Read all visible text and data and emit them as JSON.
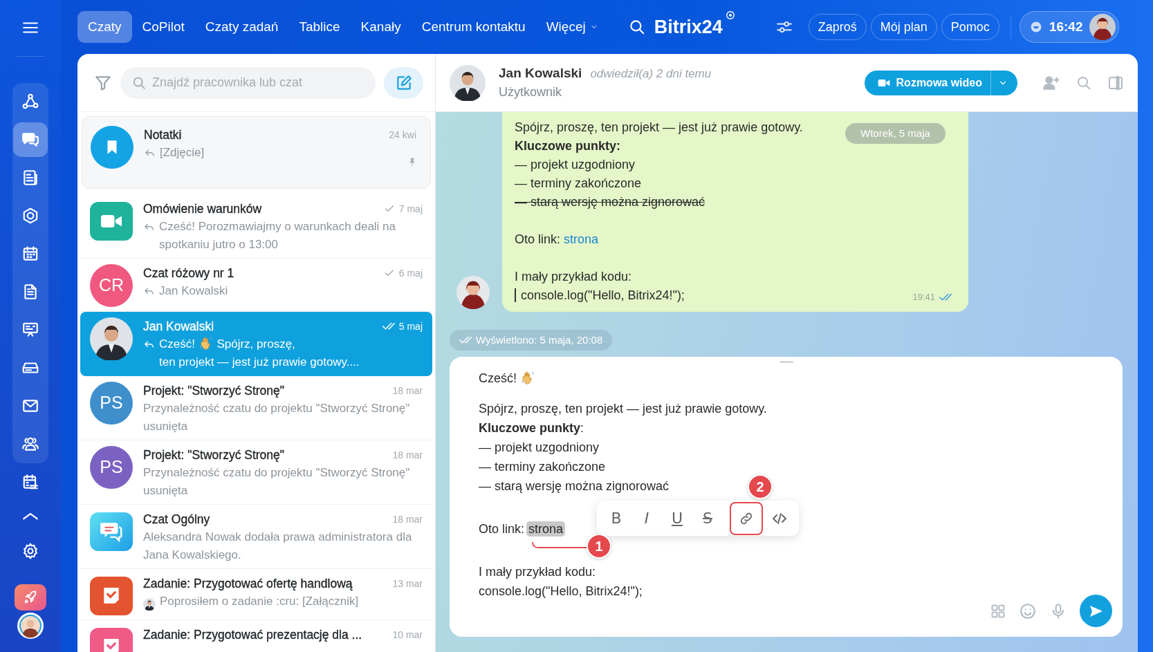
{
  "top_nav": {
    "tabs": [
      {
        "label": "Czaty",
        "selected": true
      },
      {
        "label": "CoPilot",
        "selected": false
      },
      {
        "label": "Czaty zadań",
        "selected": false
      },
      {
        "label": "Tablice",
        "selected": false
      },
      {
        "label": "Kanały",
        "selected": false
      },
      {
        "label": "Centrum kontaktu",
        "selected": false
      },
      {
        "label": "Więcej",
        "selected": false,
        "has_menu": true
      }
    ],
    "logo": "Bitrix24",
    "buttons": [
      "Zaproś",
      "Mój plan",
      "Pomoc"
    ],
    "clock": "16:42"
  },
  "rail": {
    "group": [
      {
        "kind": "flow",
        "selected": false
      },
      {
        "kind": "chats",
        "selected": true
      },
      {
        "kind": "news",
        "selected": false
      },
      {
        "kind": "hexagon",
        "selected": false
      },
      {
        "kind": "calendar",
        "selected": false
      },
      {
        "kind": "document",
        "selected": false
      },
      {
        "kind": "bpm",
        "selected": false
      },
      {
        "kind": "drive",
        "selected": false
      },
      {
        "kind": "mail",
        "selected": false
      },
      {
        "kind": "people",
        "selected": false
      }
    ],
    "items": [
      {
        "kind": "tasks",
        "selected": false
      },
      {
        "kind": "collapse",
        "selected": false
      },
      {
        "kind": "settings",
        "selected": false
      },
      {
        "kind": "rocket",
        "selected": false
      }
    ]
  },
  "chat_list": {
    "search": {
      "placeholder": "Znajdź pracownika lub czat"
    },
    "items": [
      {
        "title": "Notatki",
        "time": "24 kwi",
        "reply": true,
        "preview": [
          {
            "kind": "text",
            "text": "[Zdjęcie]"
          }
        ],
        "avatar": {
          "kind": "notes"
        },
        "pinned": true,
        "selected": false
      },
      {
        "title": "Omówienie warunków",
        "time": "7 maj",
        "sent": true,
        "read": false,
        "reply": true,
        "preview": [
          {
            "kind": "text",
            "text": "Cześć! Porozmawiajmy o warunkach deali na spotkaniu jutro o 13:00"
          }
        ],
        "avatar": {
          "kind": "video"
        },
        "pinned": false,
        "selected": false
      },
      {
        "title": "Czat różowy nr 1",
        "time": "6 maj",
        "sent": true,
        "read": false,
        "reply": true,
        "preview": [
          {
            "kind": "text",
            "text": "Jan Kowalski"
          }
        ],
        "avatar": {
          "kind": "initials",
          "text": "CR",
          "color": "#f0587f"
        },
        "pinned": false,
        "selected": false
      },
      {
        "title": "Jan Kowalski",
        "time": "5 maj",
        "sent": true,
        "read": true,
        "reply": true,
        "preview": [
          {
            "kind": "text",
            "text": "Cześć!"
          },
          {
            "kind": "wave"
          },
          {
            "kind": "text",
            "text": "Spójrz, proszę,"
          },
          {
            "kind": "text",
            "text": "ten projekt — jest już prawie gotowy...."
          }
        ],
        "avatar": {
          "kind": "photo"
        },
        "pinned": false,
        "selected": true
      },
      {
        "title": "Projekt: \"Stworzyć Stronę\"",
        "time": "18 mar",
        "reply": false,
        "preview": [
          {
            "kind": "text",
            "text": "Przynależność czatu do projektu \"Stworzyć Stronę\" usunięta"
          }
        ],
        "avatar": {
          "kind": "initials",
          "text": "PS",
          "color": "#3f8fcc"
        },
        "pinned": false,
        "selected": false
      },
      {
        "title": "Projekt: \"Stworzyć Stronę\"",
        "time": "18 mar",
        "reply": false,
        "preview": [
          {
            "kind": "text",
            "text": "Przynależność czatu do projektu \"Stworzyć Stronę\" usunięta"
          }
        ],
        "avatar": {
          "kind": "initials",
          "text": "PS",
          "color": "#7b62c2"
        },
        "pinned": false,
        "selected": false
      },
      {
        "title": "Czat Ogólny",
        "time": "18 mar",
        "reply": false,
        "preview": [
          {
            "kind": "text",
            "text": "Aleksandra Nowak dodała prawa administratora dla Jana Kowalskiego."
          }
        ],
        "avatar": {
          "kind": "group"
        },
        "pinned": false,
        "selected": false
      },
      {
        "title": "Zadanie: Przygotować ofertę handlową",
        "time": "13 mar",
        "reply": false,
        "preview": [
          {
            "kind": "author"
          },
          {
            "kind": "text",
            "text": "Poprosiłem o zadanie :cru: [Załącznik]"
          }
        ],
        "avatar": {
          "kind": "task",
          "color": "#e4532f"
        },
        "pinned": false,
        "selected": false
      },
      {
        "title": "Zadanie: Przygotować prezentację dla ...",
        "time": "10 mar",
        "reply": false,
        "avatar": {
          "kind": "task",
          "color": "#ef5b86"
        },
        "pinned": false,
        "selected": false
      }
    ]
  },
  "chat": {
    "header": {
      "name": "Jan Kowalski",
      "last_seen": "odwiedził(a) 2 dni temu",
      "role": "Użytkownik",
      "call_button": "Rozmowa wideo"
    },
    "date_pill": "Wtorek, 5 maja",
    "message": {
      "lines": [
        {
          "kind": "text",
          "text": "Spójrz, proszę, ten projekt — jest już prawie gotowy."
        },
        {
          "kind": "bold",
          "text": "Kluczowe punkty:"
        },
        {
          "kind": "text",
          "text": "— projekt uzgodniony"
        },
        {
          "kind": "text",
          "text": "— terminy zakończone"
        },
        {
          "kind": "strike",
          "text": "— starą wersję można zignorować"
        },
        {
          "kind": "link",
          "text": "Oto link:",
          "link": "strona",
          "space_before": true
        },
        {
          "kind": "text",
          "text": "I mały przykład kodu:",
          "space_before": true
        },
        {
          "kind": "code",
          "text": "console.log(\"Hello, Bitrix24!\");"
        }
      ],
      "time": "19:41",
      "read": true
    },
    "viewed": "Wyświetlono: 5 maja, 20:08"
  },
  "composer": {
    "lines": [
      {
        "kind": "greeting",
        "text": "Cześć!"
      },
      {
        "kind": "text",
        "text": "Spójrz, proszę, ten projekt — jest już prawie gotowy."
      },
      {
        "kind": "text",
        "text": "**Kluczowe punkty**:"
      },
      {
        "kind": "text",
        "text": "— projekt uzgodniony"
      },
      {
        "kind": "text",
        "text": "— terminy zakończone"
      },
      {
        "kind": "text",
        "text": "— starą wersję można zignorować"
      },
      {
        "kind": "selection",
        "text": "Oto link:",
        "selected_text": "strona",
        "space_before": true
      },
      {
        "kind": "text",
        "text": "I mały przykład kodu:",
        "space_before": true
      },
      {
        "kind": "text",
        "text": "console.log(\"Hello, Bitrix24!\");"
      }
    ],
    "format_buttons": [
      {
        "kind": "bold",
        "label": "B",
        "highlighted": false
      },
      {
        "kind": "italic",
        "label": "I",
        "highlighted": false
      },
      {
        "kind": "underline",
        "label": "U",
        "highlighted": false
      },
      {
        "kind": "strike",
        "label": "S",
        "highlighted": false
      },
      {
        "kind": "link",
        "highlighted": true
      },
      {
        "kind": "code",
        "highlighted": false
      }
    ],
    "callouts": [
      "1",
      "2"
    ]
  }
}
